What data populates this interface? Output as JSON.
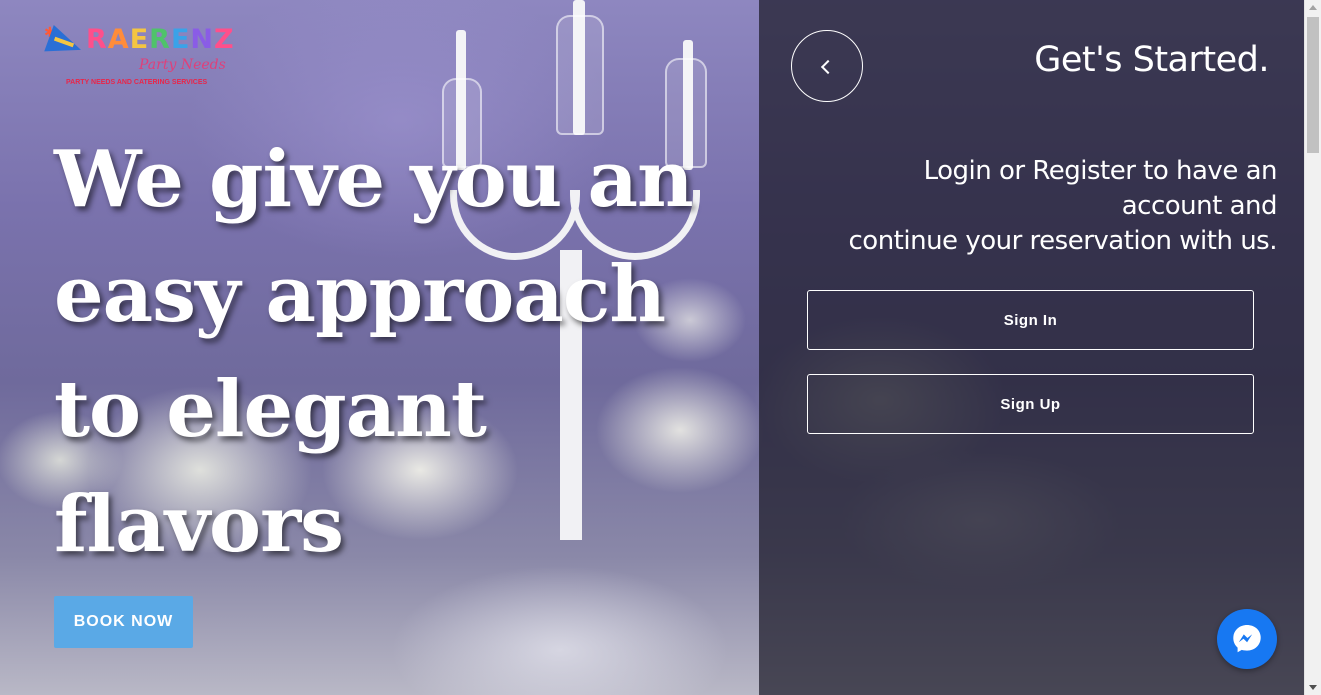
{
  "brand": {
    "word_letters": [
      "R",
      "A",
      "E",
      "R",
      "E",
      "N",
      "Z"
    ],
    "subtitle": "Party Needs",
    "tagline": "PARTY NEEDS AND CATERING SERVICES"
  },
  "hero": {
    "headline": "We give you an easy approach to elegant flavors",
    "book_button": "BOOK NOW"
  },
  "panel": {
    "title": "Get's Started.",
    "subtitle_line1": "Login or Register to have an",
    "subtitle_line2": "account and",
    "subtitle_line3": "continue your reservation with us.",
    "signin_label": "Sign In",
    "signup_label": "Sign Up"
  },
  "colors": {
    "book_button_bg": "#5aa9e6",
    "messenger_bg": "#1778f2",
    "overlay": "#1c1a28"
  },
  "icons": {
    "back": "chevron-left-icon",
    "chat": "messenger-icon"
  }
}
